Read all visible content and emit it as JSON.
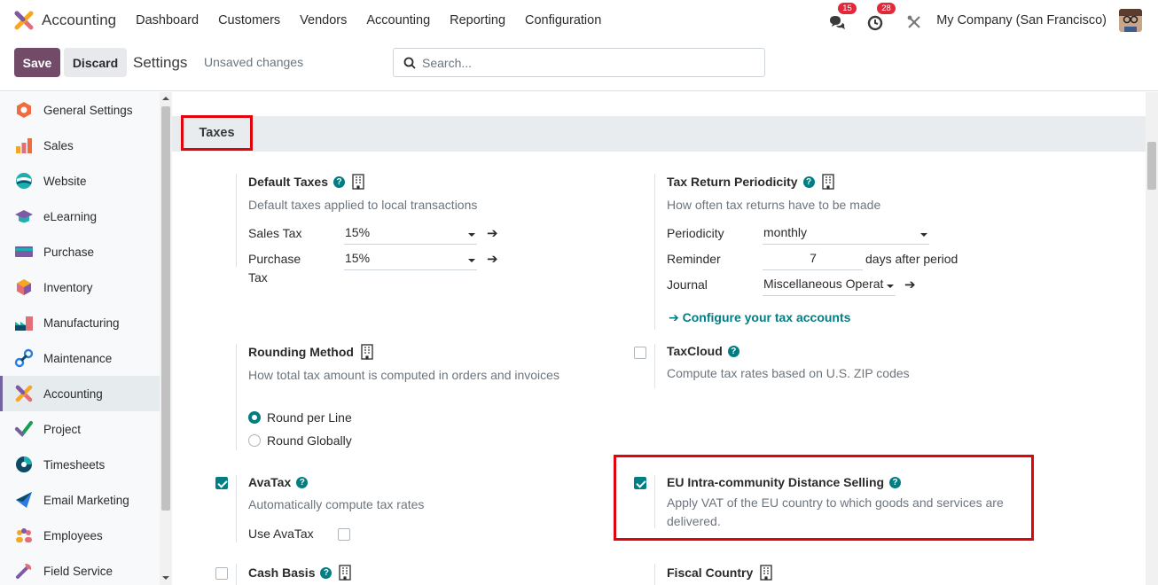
{
  "topnav": {
    "app_name": "Accounting",
    "menu": [
      "Dashboard",
      "Customers",
      "Vendors",
      "Accounting",
      "Reporting",
      "Configuration"
    ],
    "messages_count": "15",
    "activities_count": "28",
    "company": "My Company (San Francisco)"
  },
  "controlbar": {
    "save_label": "Save",
    "discard_label": "Discard",
    "title": "Settings",
    "status": "Unsaved changes",
    "search_placeholder": "Search..."
  },
  "sidebar": {
    "items": [
      {
        "label": "General Settings",
        "icon": "general-settings-icon"
      },
      {
        "label": "Sales",
        "icon": "sales-icon"
      },
      {
        "label": "Website",
        "icon": "website-icon"
      },
      {
        "label": "eLearning",
        "icon": "elearning-icon"
      },
      {
        "label": "Purchase",
        "icon": "purchase-icon"
      },
      {
        "label": "Inventory",
        "icon": "inventory-icon"
      },
      {
        "label": "Manufacturing",
        "icon": "manufacturing-icon"
      },
      {
        "label": "Maintenance",
        "icon": "maintenance-icon"
      },
      {
        "label": "Accounting",
        "icon": "accounting-icon",
        "active": true
      },
      {
        "label": "Project",
        "icon": "project-icon"
      },
      {
        "label": "Timesheets",
        "icon": "timesheets-icon"
      },
      {
        "label": "Email Marketing",
        "icon": "email-marketing-icon"
      },
      {
        "label": "Employees",
        "icon": "employees-icon"
      },
      {
        "label": "Field Service",
        "icon": "field-service-icon"
      }
    ]
  },
  "section": {
    "title": "Taxes"
  },
  "default_taxes": {
    "title": "Default Taxes",
    "desc": "Default taxes applied to local transactions",
    "sales_tax_label": "Sales Tax",
    "sales_tax_value": "15%",
    "purchase_tax_label_1": "Purchase",
    "purchase_tax_label_2": "Tax",
    "purchase_tax_value": "15%"
  },
  "tax_return": {
    "title": "Tax Return Periodicity",
    "desc": "How often tax returns have to be made",
    "periodicity_label": "Periodicity",
    "periodicity_value": "monthly",
    "reminder_label": "Reminder",
    "reminder_value": "7",
    "reminder_suffix": "days after period",
    "journal_label": "Journal",
    "journal_value": "Miscellaneous Operat",
    "configure_link": "Configure your tax accounts"
  },
  "rounding": {
    "title": "Rounding Method",
    "desc": "How total tax amount is computed in orders and invoices",
    "option_line": "Round per Line",
    "option_global": "Round Globally",
    "selected": "Round per Line"
  },
  "taxcloud": {
    "title": "TaxCloud",
    "desc": "Compute tax rates based on U.S. ZIP codes",
    "checked": false
  },
  "avatax": {
    "title": "AvaTax",
    "desc": "Automatically compute tax rates",
    "use_label": "Use AvaTax",
    "checked": true,
    "use_checked": false
  },
  "eu_distance": {
    "title": "EU Intra-community Distance Selling",
    "desc_line1": "Apply VAT of the EU country to which goods and services are",
    "desc_line2": "delivered.",
    "checked": true
  },
  "cash_basis": {
    "title": "Cash Basis",
    "checked": false
  },
  "fiscal_country": {
    "title": "Fiscal Country"
  },
  "colors": {
    "brand": "#714b67",
    "accent": "#017e84",
    "highlight": "#e0050c",
    "badge": "#e0293a"
  }
}
